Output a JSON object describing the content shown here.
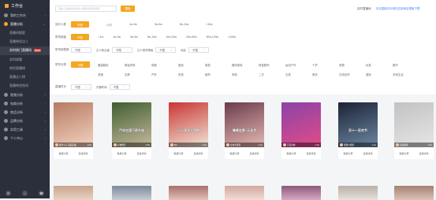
{
  "brand": {
    "title": "工作台"
  },
  "sidebar": {
    "groups": [
      {
        "label": "我的工作台"
      },
      {
        "label": "直播分析"
      }
    ],
    "items": [
      {
        "label": "直播间搜索"
      },
      {
        "label": "直播带货达人"
      },
      {
        "label": "实时热门直播间",
        "badge": "NEW"
      },
      {
        "label": "实时观看"
      },
      {
        "label": "带货直播榜"
      },
      {
        "label": "直播达人榜"
      },
      {
        "label": "直播带货热词"
      }
    ],
    "groups2": [
      {
        "label": "视频分析"
      },
      {
        "label": "电商分析"
      },
      {
        "label": "商品分析"
      },
      {
        "label": "品牌分析"
      },
      {
        "label": "实用工具"
      },
      {
        "label": "个人中心"
      }
    ],
    "bottom_icons": [
      "chat-icon",
      "home-icon",
      "phone-icon"
    ]
  },
  "search": {
    "placeholder": "请输入直播间标题/达人昵称/抖音号搜索",
    "button": "搜索"
  },
  "top_right": {
    "label": "实时直播间",
    "link": "无法直接访问请在应用商店搜索下载"
  },
  "filters": {
    "row1": {
      "label": "实时人数",
      "options": [
        "不限",
        "<1万",
        "1w-3w",
        "3w-5w",
        "5w-10w",
        ">10w"
      ],
      "active": 0
    },
    "row2": {
      "label": "带货销量",
      "options": [
        "不限",
        "<1w",
        "1w-3w",
        "3w-5w",
        "5w-10w",
        "10w-20w",
        "20w-50w",
        "50w-100w",
        ">100w"
      ],
      "active": 0
    },
    "row3": {
      "label": "带货销售额",
      "selects": [
        {
          "label": "不限"
        },
        {
          "label": "达人粉丝量"
        },
        {
          "label": "不限"
        },
        {
          "label": "达人带货等级"
        },
        {
          "label": "不限"
        },
        {
          "label": "地区"
        },
        {
          "label": "不限"
        }
      ]
    },
    "category": {
      "label": "带货分类",
      "options": [
        "不限",
        "服装鞋包",
        "美妆护肤",
        "母婴",
        "食品",
        "家居",
        "数码家电",
        "珠宝配饰",
        "运动户外",
        "个护",
        "宠物",
        "玩具",
        "图书",
        "茶酒",
        "生鲜",
        "汽车",
        "农资",
        "医药",
        "其他",
        "二手",
        "文具",
        "家纺",
        "日用百货",
        "虚拟",
        "本地生活"
      ],
      "active": 0
    },
    "row5": {
      "label": "直播时长",
      "selects": [
        {
          "label": "不限"
        },
        {
          "label": "开播时间"
        },
        {
          "label": "不限"
        }
      ]
    }
  },
  "cards": [
    {
      "caption": "",
      "name": "图片公子·商品直播",
      "views": "1.5w",
      "colors": [
        "#b77a61",
        "#f2d3c1"
      ]
    },
    {
      "caption": "汽车加酒万两东坡",
      "name": "好物推荐",
      "views": "1.6w",
      "colors": [
        "#3f5e2f",
        "#c7b99d"
      ]
    },
    {
      "caption": "1111现场大团购",
      "name": "MC",
      "views": "1.2w",
      "colors": [
        "#c93632",
        "#f0e6d9"
      ]
    },
    {
      "caption": "情感连麦1元选货",
      "name": "女神大蓉蓉",
      "views": "1.1w",
      "colors": [
        "#6a3b4c",
        "#e7b9b2"
      ]
    },
    {
      "caption": "",
      "name": "百货好物",
      "views": "1.3w",
      "colors": [
        "#8a43a8",
        "#e24c87"
      ]
    },
    {
      "caption": "双十一狂欢节",
      "name": "甜甜小姐姐",
      "views": "1.1w",
      "colors": [
        "#1c2236",
        "#6b88a2"
      ]
    },
    {
      "caption": "",
      "name": "新品团购",
      "views": "1.0w",
      "colors": [
        "#c2c2c2",
        "#e6e6e6"
      ]
    }
  ],
  "card_actions": {
    "a": "数据大屏",
    "b": "直播详情"
  }
}
